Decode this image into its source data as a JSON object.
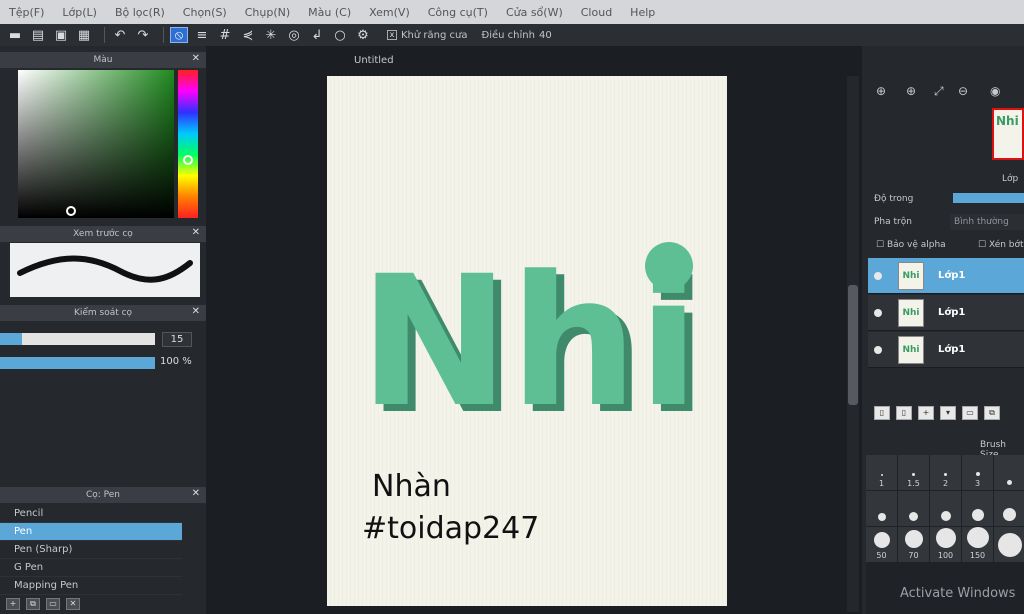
{
  "menu": [
    "Tệp(F)",
    "Lớp(L)",
    "Bộ lọc(R)",
    "Chọn(S)",
    "Chụp(N)",
    "Màu (C)",
    "Xem(V)",
    "Công cụ(T)",
    "Cửa sổ(W)",
    "Cloud",
    "Help"
  ],
  "toolbar": {
    "antialias_label": "Khử răng cưa",
    "adjust_label": "Điều chỉnh",
    "adjust_value": "40",
    "antialias_checked": "x"
  },
  "panels": {
    "color_title": "Màu",
    "brush_preview_title": "Xem trước cọ",
    "brush_control_title": "Kiểm soát cọ",
    "brush_size_value": "15",
    "brush_opacity_value": "100 %",
    "brush_list_title": "Cọ: Pen",
    "brushes": [
      "Pencil",
      "Pen",
      "Pen (Sharp)",
      "G Pen",
      "Mapping Pen"
    ],
    "selected_brush": "Pen"
  },
  "canvas": {
    "doc_title": "Untitled",
    "drawing_big": "Nhi",
    "drawing_line1": "Nhàn",
    "drawing_line2": "#toidap247"
  },
  "right": {
    "layer_title": "Lớp",
    "opacity_label": "Độ trong",
    "blend_label": "Pha trộn",
    "blend_value": "Bình thường",
    "protect_alpha": "Bảo vệ alpha",
    "clip_label": "Xén bớt",
    "layers": [
      "Lớp1",
      "Lớp1",
      "Lớp1"
    ],
    "brush_size_title": "Brush Size",
    "brush_sizes": [
      "1",
      "1.5",
      "2",
      "3",
      "",
      "",
      "",
      "",
      "",
      "",
      "50",
      "70",
      "100",
      "150",
      ""
    ],
    "thumb_text": "Nhi"
  },
  "watermark": "Activate Windows",
  "colors": {
    "accent": "#5aa7d8",
    "teal": "#4cac85"
  }
}
